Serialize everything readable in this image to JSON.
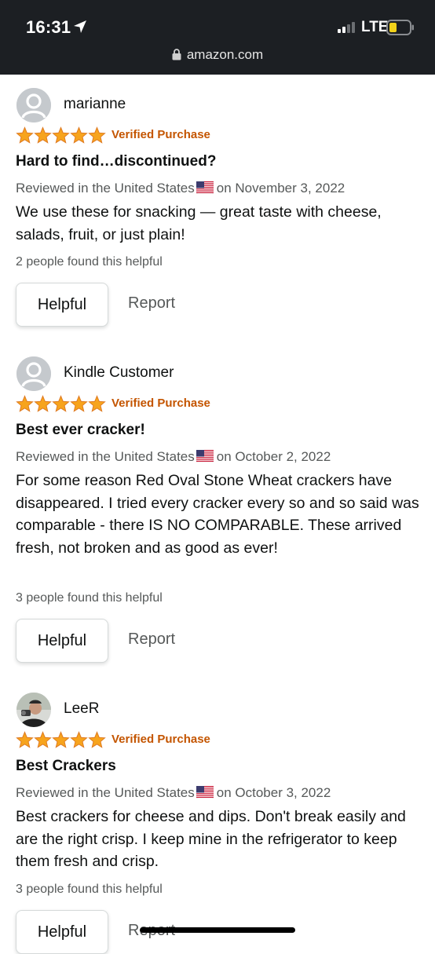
{
  "status_bar": {
    "time": "16:31",
    "network": "LTE",
    "icons": [
      "location-arrow-icon",
      "signal-icon",
      "battery-icon"
    ]
  },
  "browser": {
    "url": "amazon.com",
    "lock_icon": "lock-icon"
  },
  "colors": {
    "star": "#f7a41d",
    "verified": "#c45500",
    "topbar": "#1c1f23"
  },
  "reviews": [
    {
      "author": "marianne",
      "avatar": "default-avatar-icon",
      "rating": 5,
      "badge": "Verified Purchase",
      "title": "Hard to find…discontinued?",
      "meta_prefix": "Reviewed in the United States",
      "meta_date": "on November 3, 2022",
      "body": "We use these for snacking — great taste with cheese, salads, fruit, or just plain!",
      "helpful_count": "2 people found this helpful",
      "helpful_label": "Helpful",
      "report_label": "Report"
    },
    {
      "author": "Kindle Customer",
      "avatar": "default-avatar-icon",
      "rating": 5,
      "badge": "Verified Purchase",
      "title": "Best ever cracker!",
      "meta_prefix": "Reviewed in the United States",
      "meta_date": "on October 2, 2022",
      "body": "For some reason Red Oval Stone Wheat crackers have disappeared. I tried every cracker every so and so said was comparable - there IS NO COMPARABLE. These arrived fresh, not broken and as good as ever!",
      "helpful_count": "3 people found this helpful",
      "helpful_label": "Helpful",
      "report_label": "Report"
    },
    {
      "author": "LeeR",
      "avatar": "user-photo-avatar",
      "rating": 5,
      "badge": "Verified Purchase",
      "title": "Best Crackers",
      "meta_prefix": "Reviewed in the United States",
      "meta_date": "on October 3, 2022",
      "body": "Best crackers for cheese and dips. Don't break easily and are the right crisp. I keep mine in the refrigerator to keep them fresh and crisp.",
      "helpful_count": "3 people found this helpful",
      "helpful_label": "Helpful",
      "report_label": "Report"
    }
  ]
}
